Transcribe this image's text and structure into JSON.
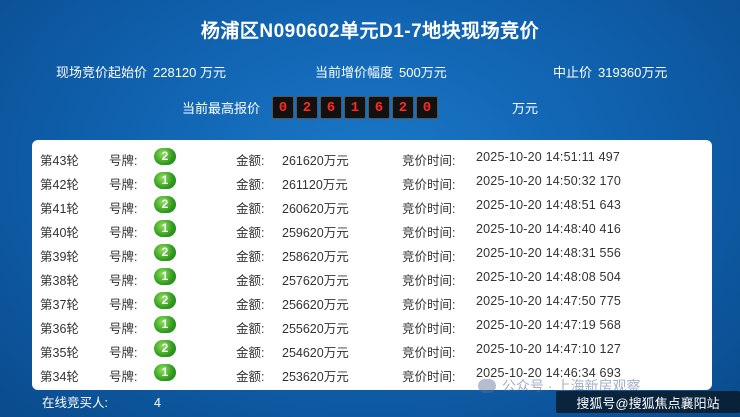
{
  "title": "杨浦区N090602单元D1-7地块现场竞价",
  "stats": {
    "start_label": "现场竞价起始价",
    "start_value": "228120 万元",
    "increment_label": "当前增价幅度",
    "increment_value": "500万元",
    "cap_label": "中止价",
    "cap_value": "319360万元"
  },
  "current_bid": {
    "label": "当前最高报价",
    "digits": [
      "0",
      "2",
      "6",
      "1",
      "6",
      "2",
      "0"
    ],
    "unit": "万元"
  },
  "labels": {
    "plate": "号牌:",
    "amount": "金额:",
    "time": "竞价时间:"
  },
  "rounds": [
    {
      "round": "第43轮",
      "plate": "2",
      "amount": "261620万元",
      "time": "2025-10-20 14:51:11 497"
    },
    {
      "round": "第42轮",
      "plate": "1",
      "amount": "261120万元",
      "time": "2025-10-20 14:50:32 170"
    },
    {
      "round": "第41轮",
      "plate": "2",
      "amount": "260620万元",
      "time": "2025-10-20 14:48:51 643"
    },
    {
      "round": "第40轮",
      "plate": "1",
      "amount": "259620万元",
      "time": "2025-10-20 14:48:40 416"
    },
    {
      "round": "第39轮",
      "plate": "2",
      "amount": "258620万元",
      "time": "2025-10-20 14:48:31 556"
    },
    {
      "round": "第38轮",
      "plate": "1",
      "amount": "257620万元",
      "time": "2025-10-20 14:48:08 504"
    },
    {
      "round": "第37轮",
      "plate": "2",
      "amount": "256620万元",
      "time": "2025-10-20 14:47:50 775"
    },
    {
      "round": "第36轮",
      "plate": "1",
      "amount": "255620万元",
      "time": "2025-10-20 14:47:19 568"
    },
    {
      "round": "第35轮",
      "plate": "2",
      "amount": "254620万元",
      "time": "2025-10-20 14:47:10 127"
    },
    {
      "round": "第34轮",
      "plate": "1",
      "amount": "253620万元",
      "time": "2025-10-20 14:46:34 693"
    }
  ],
  "online": {
    "label": "在线竞买人:",
    "count": "4"
  },
  "watermark": "公众号 · 上海新房观察",
  "source_badge": "搜狐号@搜狐焦点襄阳站"
}
